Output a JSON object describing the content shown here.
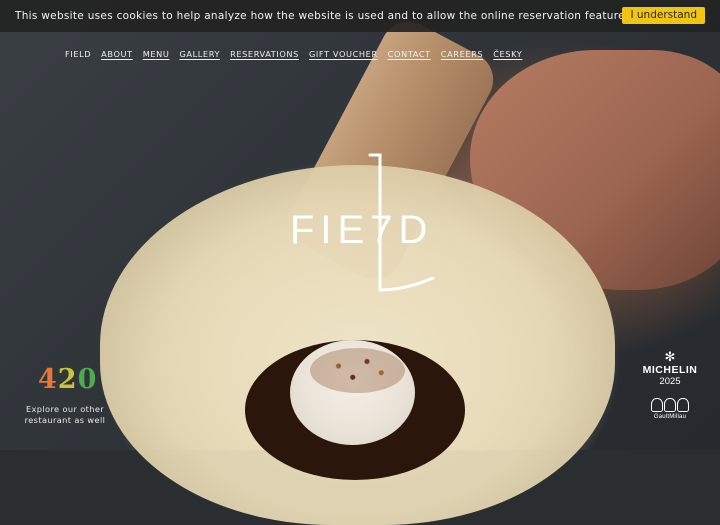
{
  "cookie_bar": {
    "message": "This website uses cookies to help analyze how the website is used and to allow the online reservation features.",
    "accept_label": "I understand"
  },
  "nav": {
    "items": [
      "FIELD",
      "ABOUT",
      "MENU",
      "GALLERY",
      "RESERVATIONS",
      "GIFT VOUCHER",
      "CONTACT",
      "CAREERS",
      "ČESKY"
    ]
  },
  "logo": {
    "text": "FIE7D"
  },
  "promo": {
    "number": "420",
    "digits": [
      "4",
      "2",
      "0"
    ],
    "caption_line1": "Explore our other",
    "caption_line2": "restaurant as well"
  },
  "awards": {
    "michelin_icon": "michelin-star-icon",
    "michelin_label": "MICHELIN",
    "michelin_year": "2025",
    "gaultmillau_icon": "toque-hats-icon",
    "gaultmillau_label": "GaultMillau"
  },
  "colors": {
    "cookie_button": "#f1c40f",
    "n420_4": "#e8763a",
    "n420_2": "#c9c43a",
    "n420_0": "#4fa94d"
  }
}
